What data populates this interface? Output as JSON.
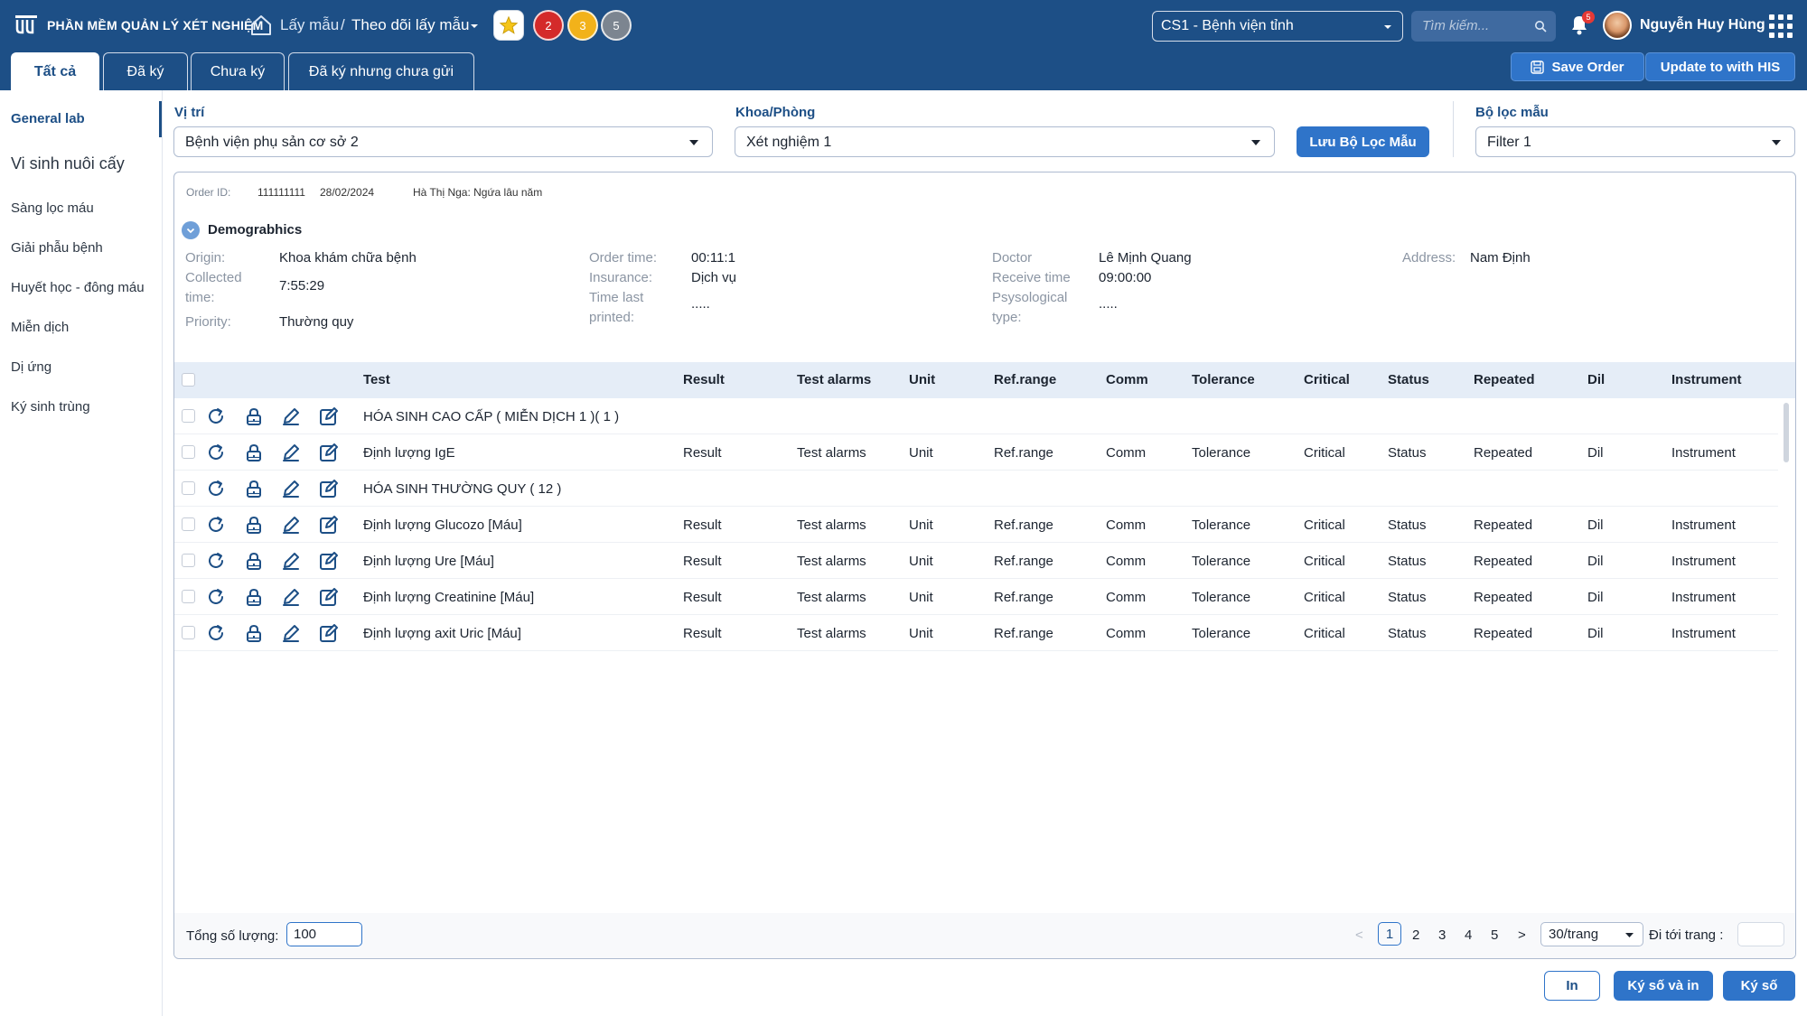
{
  "header": {
    "app_title": "PHẦN MỀM QUẢN LÝ XÉT NGHIỆM",
    "breadcrumb": [
      "Lấy mẫu",
      "/",
      "Theo dõi lấy mẫu"
    ],
    "counters": [
      "2",
      "3",
      "5"
    ],
    "site": "CS1 - Bệnh viện tỉnh",
    "search_placeholder": "Tìm kiếm...",
    "notification_count": "5",
    "user_name": "Nguyễn Huy Hùng",
    "colors": {
      "bar": "#1d4f86",
      "accent": "#2f74c9",
      "red": "#d42a2a",
      "yellow": "#f2b21a",
      "gray": "#7c8590"
    }
  },
  "tabs": [
    {
      "label": "Tất cả",
      "active": true
    },
    {
      "label": "Đã ký",
      "active": false
    },
    {
      "label": "Chưa ký",
      "active": false
    },
    {
      "label": "Đã ký nhưng chưa gửi",
      "active": false
    }
  ],
  "actions": {
    "save_order": "Save Order",
    "update_his": "Update to with HIS"
  },
  "sidebar": {
    "items": [
      {
        "label": "General lab",
        "active": true
      },
      {
        "label": "Vi sinh nuôi cấy",
        "active": false
      },
      {
        "label": "Sàng lọc máu",
        "active": false
      },
      {
        "label": "Giải phẫu bệnh",
        "active": false
      },
      {
        "label": "Huyết học - đông máu",
        "active": false
      },
      {
        "label": "Miễn dịch",
        "active": false
      },
      {
        "label": "Dị ứng",
        "active": false
      },
      {
        "label": "Ký sinh trùng",
        "active": false
      }
    ]
  },
  "filters": {
    "location_label": "Vị trí",
    "location_value": "Bệnh viện phụ sản cơ sở 2",
    "department_label": "Khoa/Phòng",
    "department_value": "Xét nghiệm 1",
    "save_filter": "Lưu Bộ Lọc Mẫu",
    "sample_filter_label": "Bộ lọc mẫu",
    "sample_filter_value": "Filter 1"
  },
  "order": {
    "id_label": "Order ID:",
    "id": "111111111",
    "date": "28/02/2024",
    "patient": "Hà Thị Nga: Ngứa lâu năm"
  },
  "demographics": {
    "title": "Demograbhics",
    "origin_label": "Origin:",
    "origin": "Khoa khám chữa bệnh",
    "collected_label_1": "Collected",
    "collected_label_2": "time:",
    "collected": "7:55:29",
    "priority_label": "Priority:",
    "priority": "Thường quy",
    "order_time_label": "Order time:",
    "order_time": "00:11:1",
    "insurance_label": "Insurance:",
    "insurance": "Dịch vụ",
    "time_last_label_1": "Time last",
    "time_last_label_2": "printed:",
    "time_last": ".....",
    "doctor_label": "Doctor",
    "doctor": "Lê Mịnh Quang",
    "receive_label": "Receive time",
    "receive": "09:00:00",
    "psy_label_1": "Psysological",
    "psy_label_2": "type:",
    "psy": ".....",
    "address_label": "Address:",
    "address": "Nam Định"
  },
  "table": {
    "headers": [
      "Test",
      "Result",
      "Test alarms",
      "Unit",
      "Ref.range",
      "Comm",
      "Tolerance",
      "Critical",
      "Status",
      "Repeated",
      "Dil",
      "Instrument"
    ],
    "rows": [
      {
        "test": "HÓA SINH CAO CẤP ( MIỄN DỊCH 1 )( 1 )",
        "group": true
      },
      {
        "test": "Định lượng IgE",
        "group": false
      },
      {
        "test": "HÓA SINH THƯỜNG QUY ( 12 )",
        "group": true
      },
      {
        "test": "Định lượng Glucozo [Máu]",
        "group": false
      },
      {
        "test": "Định lượng Ure [Máu]",
        "group": false
      },
      {
        "test": "Định lượng Creatinine [Máu]",
        "group": false
      },
      {
        "test": "Định lượng axit Uric [Máu]",
        "group": false
      }
    ],
    "row_values": {
      "result": "Result",
      "test_alarms": "Test alarms",
      "unit": "Unit",
      "ref_range": "Ref.range",
      "comm": "Comm",
      "tolerance": "Tolerance",
      "critical": "Critical",
      "status": "Status",
      "repeated": "Repeated",
      "dil": "Dil",
      "instrument": "Instrument"
    }
  },
  "pagination": {
    "total_label": "Tổng số lượng:",
    "total_value": "100",
    "pages": [
      "1",
      "2",
      "3",
      "4",
      "5"
    ],
    "current_page": "1",
    "prev": "<",
    "next": ">",
    "per_page": "30/trang",
    "goto_label": "Đi tới trang :"
  },
  "bottom": {
    "print": "In",
    "sign_print": "Ký số và in",
    "sign": "Ký số"
  }
}
